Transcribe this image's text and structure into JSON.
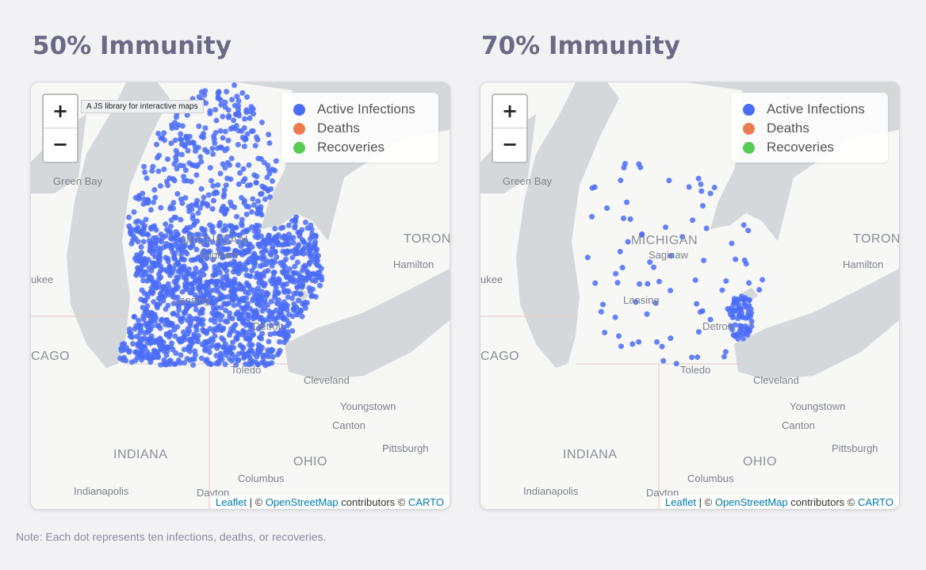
{
  "panels": [
    {
      "title": "50% Immunity",
      "tooltip": "A JS library for interactive maps",
      "density": "high"
    },
    {
      "title": "70% Immunity",
      "density": "low"
    }
  ],
  "zoom": {
    "in": "+",
    "out": "−"
  },
  "legend": [
    {
      "label": "Active Infections",
      "color": "#4a6cf7"
    },
    {
      "label": "Deaths",
      "color": "#ee7a50"
    },
    {
      "label": "Recoveries",
      "color": "#56cc56"
    }
  ],
  "map_labels": {
    "green_bay": "Green Bay",
    "michigan": "MICHIGAN",
    "saginaw": "Saginaw",
    "toronto": "TORON",
    "hamilton": "Hamilton",
    "milwaukee": "ukee",
    "lansing": "Lansing",
    "detroit": "Detroit",
    "chicago": "CAGO",
    "toledo": "Toledo",
    "cleveland": "Cleveland",
    "youngstown": "Youngstown",
    "canton": "Canton",
    "pittsburgh": "Pittsburgh",
    "indiana": "INDIANA",
    "ohio": "OHIO",
    "columbus": "Columbus",
    "indianapolis": "Indianapolis",
    "dayton": "Dayton"
  },
  "attribution": {
    "leaflet": "Leaflet",
    "sep": " | © ",
    "osm": "OpenStreetMap",
    "rest": " contributors © ",
    "carto": "CARTO"
  },
  "note": "Note: Each dot represents ten infections, deaths, or recoveries."
}
